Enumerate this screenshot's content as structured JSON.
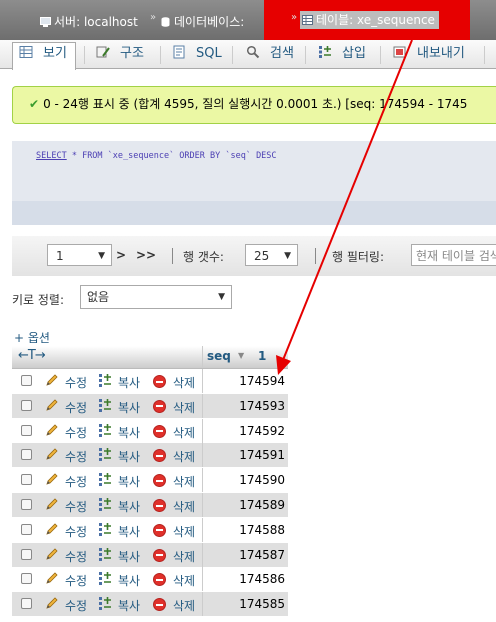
{
  "breadcrumb": {
    "server": "서버: localhost",
    "database": "데이터베이스:",
    "table": "테이블: xe_sequence"
  },
  "tabs": [
    {
      "label": "보기",
      "icon": "browse-icon"
    },
    {
      "label": "구조",
      "icon": "structure-icon"
    },
    {
      "label": "SQL",
      "icon": "sql-icon"
    },
    {
      "label": "검색",
      "icon": "search-icon"
    },
    {
      "label": "삽입",
      "icon": "insert-icon"
    },
    {
      "label": "내보내기",
      "icon": "export-icon"
    }
  ],
  "success": {
    "message": "0 - 24행 표시 중 (합계 4595, 질의 실행시간 0.0001 초.) [seq: 174594 - 1745"
  },
  "sql": {
    "select": "SELECT",
    "rest": " * FROM `xe_sequence` ORDER BY `seq` DESC"
  },
  "nav": {
    "page": "1",
    "next": ">",
    "last": ">>",
    "rows_label": "행 갯수:",
    "rows_value": "25",
    "filter_label": "행 필터링:",
    "filter_placeholder": "현재 테이블 검색"
  },
  "sort": {
    "label": "키로 정렬:",
    "value": "없음"
  },
  "options_link": "+ 옵션",
  "table": {
    "col_controls": "←T→",
    "column": "seq",
    "sort_num": "1",
    "actions": {
      "edit": "수정",
      "copy": "복사",
      "delete": "삭제"
    },
    "rows": [
      "174594",
      "174593",
      "174592",
      "174591",
      "174590",
      "174589",
      "174588",
      "174587",
      "174586",
      "174585"
    ]
  },
  "colors": {
    "annotation_red": "#e60000",
    "success_bg": "#ebf8a4",
    "link_blue": "#235a81"
  }
}
